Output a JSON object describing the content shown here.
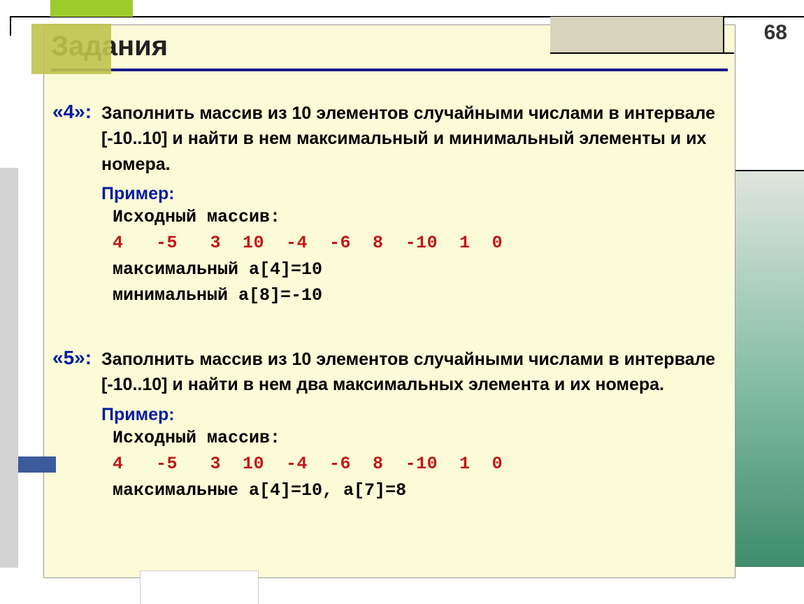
{
  "page_number": "68",
  "title": "Задания",
  "task4": {
    "grade": "«4»:",
    "desc": "Заполнить массив из 10 элементов случайными числами в интервале [-10..10] и найти в нем максимальный и минимальный элементы и их номера.",
    "example_label": "Пример:",
    "src_label": "Исходный массив:",
    "values": "4   -5   3  10  -4  -6  8  -10  1  0",
    "max_line": "максимальный a[4]=10",
    "min_line": "минимальный  a[8]=-10"
  },
  "task5": {
    "grade": "«5»:",
    "desc": "Заполнить массив из 10 элементов случайными числами в интервале [-10..10] и найти в нем два максимальных элемента и их номера.",
    "example_label": "Пример:",
    "src_label": "Исходный массив:",
    "values": "4   -5   3  10  -4  -6  8  -10  1  0",
    "max_line": "максимальные a[4]=10, a[7]=8"
  }
}
